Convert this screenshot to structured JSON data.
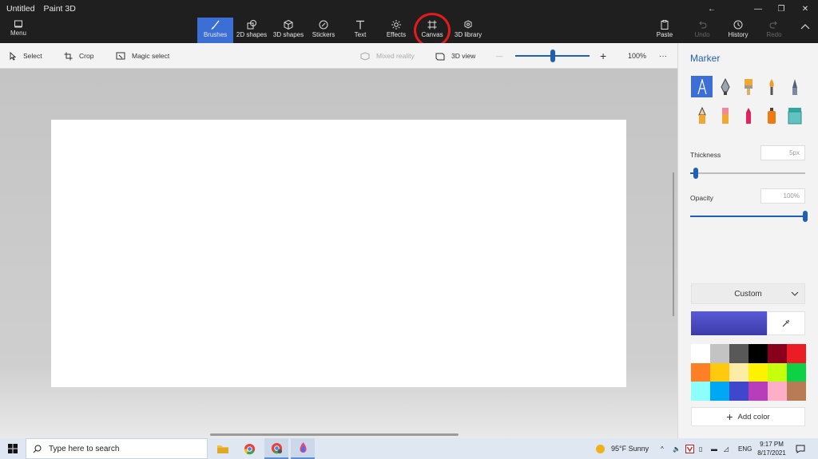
{
  "window": {
    "title_doc": "Untitled",
    "title_app": "Paint 3D",
    "minimize": "—",
    "maximize": "❐",
    "close": "✕"
  },
  "menu": {
    "label": "Menu"
  },
  "tools": {
    "brushes": "Brushes",
    "shapes2d": "2D shapes",
    "shapes3d": "3D shapes",
    "stickers": "Stickers",
    "text": "Text",
    "effects": "Effects",
    "canvas": "Canvas",
    "library3d": "3D library",
    "paste": "Paste",
    "undo": "Undo",
    "history": "History",
    "redo": "Redo"
  },
  "subtoolbar": {
    "select": "Select",
    "crop": "Crop",
    "magic_select": "Magic select",
    "mixed_reality": "Mixed reality",
    "view3d": "3D view",
    "zoom_minus": "—",
    "zoom_plus": "+",
    "zoom_level": "100%",
    "more": "···",
    "zoom_fraction": 0.5
  },
  "panel": {
    "title": "Marker",
    "thickness_label": "Thickness",
    "thickness_value": "5px",
    "thickness_fraction": 0.05,
    "opacity_label": "Opacity",
    "opacity_value": "100%",
    "opacity_fraction": 1.0,
    "color_mode": "Custom",
    "add_color": "Add color",
    "current_color_gradient": [
      "#5a5ad6",
      "#3b3ba8"
    ],
    "palette": [
      "#ffffff",
      "#c3c3c3",
      "#585858",
      "#000000",
      "#88001b",
      "#ec1c24",
      "#ff7f27",
      "#ffc90e",
      "#fdeca6",
      "#fff200",
      "#c4ff0e",
      "#0ed145",
      "#8cfffb",
      "#00a8f3",
      "#3f48cc",
      "#b83dba",
      "#ffaec8",
      "#b97a56"
    ]
  },
  "taskbar": {
    "search_placeholder": "Type here to search",
    "weather": "95°F  Sunny",
    "language": "ENG",
    "time": "9:17 PM",
    "date": "8/17/2021"
  },
  "colors": {
    "accent": "#3b6fd6",
    "annotation": "#e21b1b",
    "titlebar": "#1f1f1f"
  }
}
